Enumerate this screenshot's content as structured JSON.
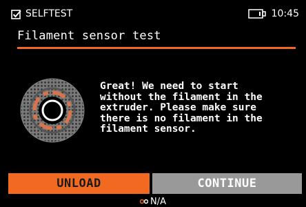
{
  "statusbar": {
    "mode_label": "SELFTEST",
    "mode_icon": "checkbox-icon",
    "storage_icon": "usb-drive-icon",
    "time": "10:45"
  },
  "screen": {
    "title": "Filament sensor test",
    "message": "Great! We need to start\nwithout the filament in the\nextruder. Please make sure\nthere is no filament in the\nfilament sensor.",
    "illustration_icon": "filament-sensor-icon"
  },
  "buttons": {
    "unload_label": "UNLOAD",
    "continue_label": "CONTINUE"
  },
  "footer": {
    "sensor_icon": "filament-indicator-icon",
    "sensor_status": "N/A"
  },
  "colors": {
    "accent": "#f26a21",
    "background": "#000000",
    "button_disabled": "#999999"
  }
}
